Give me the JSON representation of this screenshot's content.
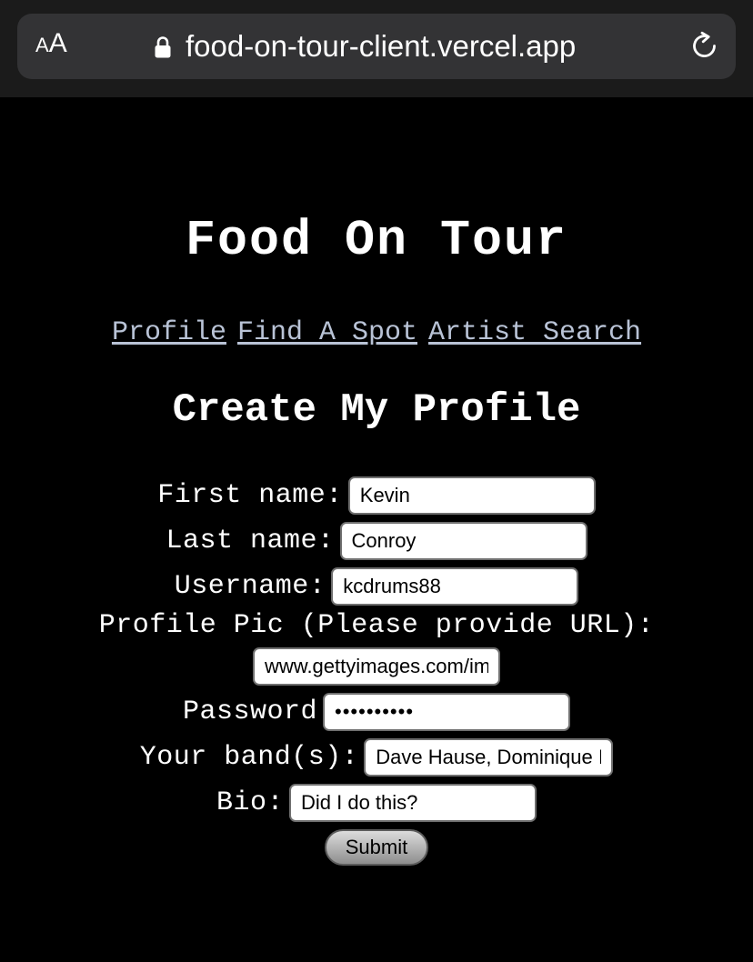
{
  "browser": {
    "text_size_label_small": "A",
    "text_size_label_large": "A",
    "url": "food-on-tour-client.vercel.app",
    "icons": [
      "text-size-icon",
      "lock-icon",
      "reload-icon"
    ]
  },
  "page": {
    "title": "Food On Tour",
    "nav": {
      "profile": "Profile",
      "find_a_spot": "Find A Spot",
      "artist_search": "Artist Search"
    },
    "form": {
      "heading": "Create My Profile",
      "first_name": {
        "label": "First name:",
        "value": "Kevin"
      },
      "last_name": {
        "label": "Last name:",
        "value": "Conroy"
      },
      "username": {
        "label": "Username:",
        "value": "kcdrums88"
      },
      "profile_pic": {
        "label": "Profile Pic (Please provide URL):",
        "value": "www.gettyimages.com/im"
      },
      "password": {
        "label": "Password",
        "value": "••••••••••"
      },
      "bands": {
        "label": "Your band(s):",
        "value": "Dave Hause, Dominique I"
      },
      "bio": {
        "label": "Bio:",
        "value": "Did I do this?"
      },
      "submit_label": "Submit"
    }
  },
  "colors": {
    "background": "#000000",
    "chrome": "#1b1b1b",
    "urlbar": "#333335",
    "link": "#b9c3d6",
    "text": "#ffffff"
  }
}
